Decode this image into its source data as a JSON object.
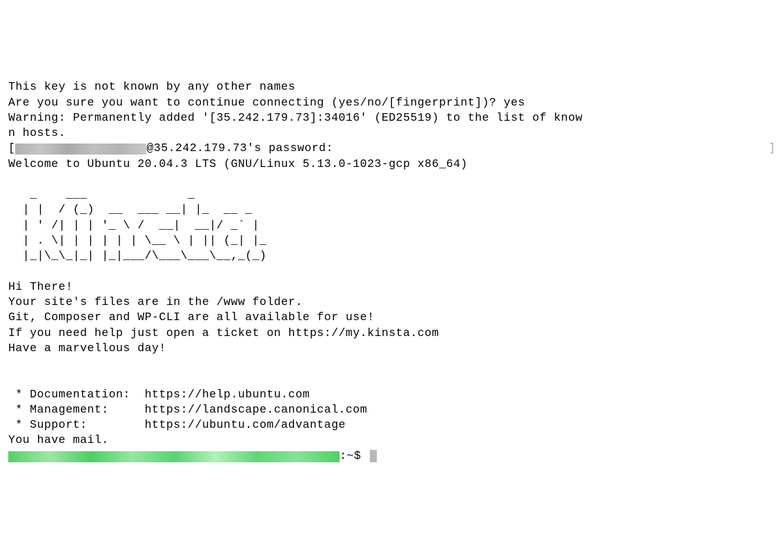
{
  "lines": {
    "l1": "This key is not known by any other names",
    "l2": "Are you sure you want to continue connecting (yes/no/[fingerprint])? yes",
    "l3": "Warning: Permanently added '[35.242.179.73]:34016' (ED25519) to the list of know",
    "l4": "n hosts.",
    "l5_prefix": "[",
    "l5_mid": "@35.242.179.73's password:",
    "l6": "Welcome to Ubuntu 20.04.3 LTS (GNU/Linux 5.13.0-1023-gcp x86_64)"
  },
  "ascii": {
    "a1": "   _    ___              _",
    "a2": "  | |  / (_)  __  ___ __| |_  __ _",
    "a3": "  | ' /| | | '_ \\ /  __|  __|/ _` |",
    "a4": "  | . \\| | | | | | \\__ \\ | || (_| |_",
    "a5": "  |_|\\_\\_|_| |_|___/\\___\\___\\__,_(_)"
  },
  "motd": {
    "m1": "Hi There!",
    "m2": "Your site's files are in the /www folder.",
    "m3": "Git, Composer and WP-CLI are all available for use!",
    "m4": "If you need help just open a ticket on https://my.kinsta.com",
    "m5": "Have a marvellous day!"
  },
  "links": {
    "doc_label": " * Documentation:  ",
    "doc_url": "https://help.ubuntu.com",
    "mgmt_label": " * Management:     ",
    "mgmt_url": "https://landscape.canonical.com",
    "sup_label": " * Support:        ",
    "sup_url": "https://ubuntu.com/advantage"
  },
  "mail": "You have mail.",
  "prompt": {
    "sep": ":",
    "path": "~",
    "sym": "$"
  }
}
